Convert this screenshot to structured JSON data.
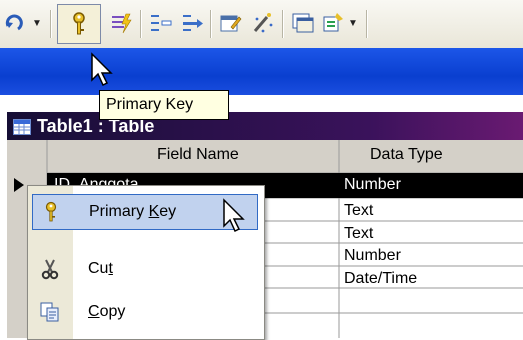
{
  "tooltip": "Primary Key",
  "table": {
    "title": "Table1 : Table",
    "headers": [
      "Field Name",
      "Data Type"
    ],
    "rows": [
      {
        "field": "ID_Anggota",
        "type": "Number"
      },
      {
        "field": "",
        "type": "Text"
      },
      {
        "field": "",
        "type": "Text"
      },
      {
        "field": "",
        "type": "Number"
      },
      {
        "field": "",
        "type": "Date/Time"
      },
      {
        "field": "",
        "type": ""
      }
    ]
  },
  "context_menu": {
    "items": [
      {
        "label": "Primary Key",
        "access_key": "K",
        "icon": "key-icon",
        "highlighted": true
      },
      {
        "label": "Cut",
        "access_key": "t",
        "icon": "scissors-icon"
      },
      {
        "label": "Copy",
        "access_key": "C",
        "icon": "copy-icon"
      }
    ]
  },
  "colors": {
    "toolbar": "#ece9d8",
    "titlebar_blue": "#0a3fd0",
    "table_title": "#2a1048",
    "menu_highlight": "#c1d2ee",
    "tooltip_bg": "#ffffe1"
  }
}
